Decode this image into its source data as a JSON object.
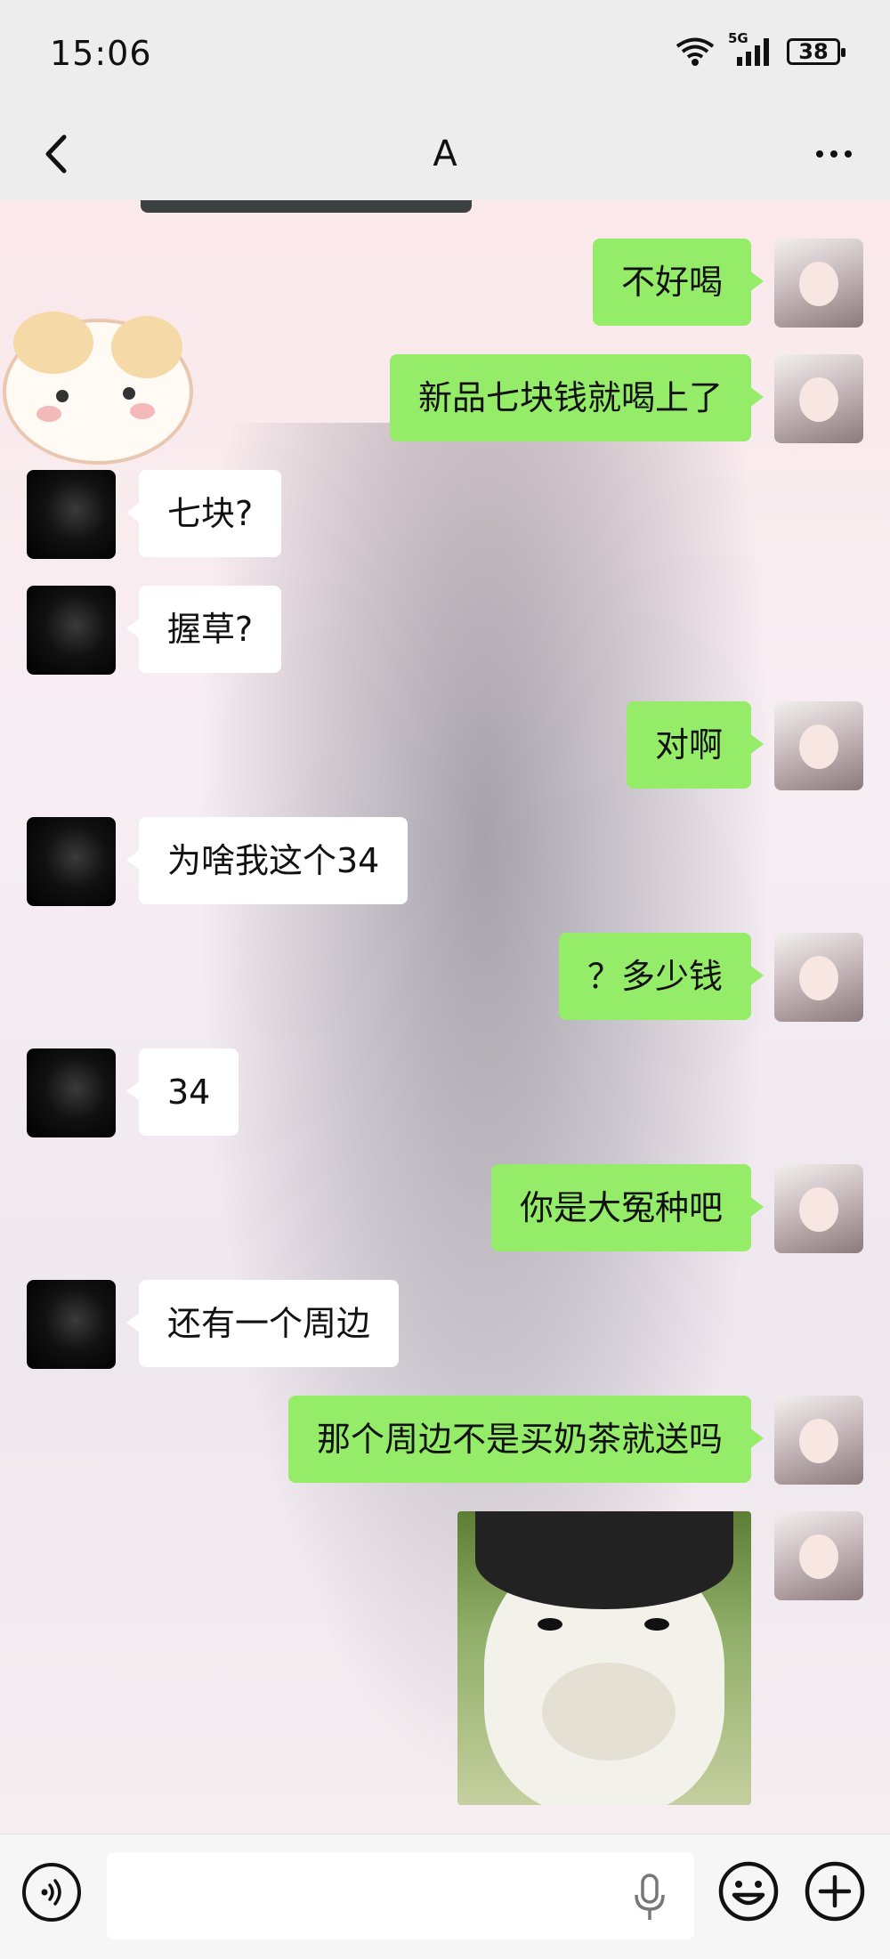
{
  "status_bar": {
    "time": "15:06",
    "network": "5G",
    "battery": "38"
  },
  "nav": {
    "title": "A",
    "back_icon": "chevron-left-icon",
    "more_icon": "more-dots-icon"
  },
  "messages": [
    {
      "sender": "me",
      "text": "不好喝"
    },
    {
      "sender": "me",
      "text": "新品七块钱就喝上了"
    },
    {
      "sender": "them",
      "text": "七块?"
    },
    {
      "sender": "them",
      "text": "握草?"
    },
    {
      "sender": "me",
      "text": "对啊"
    },
    {
      "sender": "them",
      "text": "为啥我这个34"
    },
    {
      "sender": "me",
      "text": "？多少钱"
    },
    {
      "sender": "them",
      "text": "34"
    },
    {
      "sender": "me",
      "text": "你是大冤种吧"
    },
    {
      "sender": "them",
      "text": "还有一个周边"
    },
    {
      "sender": "me",
      "text": "那个周边不是买奶茶就送吗"
    },
    {
      "sender": "me",
      "type": "sticker",
      "text": ""
    }
  ],
  "input_bar": {
    "placeholder": "",
    "voice_icon": "voice-icon",
    "mic_icon": "mic-icon",
    "emoji_icon": "emoji-icon",
    "plus_icon": "plus-icon"
  },
  "colors": {
    "my_bubble": "#95ec69",
    "their_bubble": "#ffffff",
    "bar_bg": "#ededed"
  }
}
